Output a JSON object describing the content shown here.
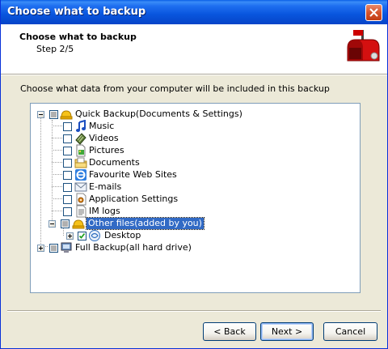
{
  "window": {
    "title": "Choose what to backup"
  },
  "header": {
    "title": "Choose what to backup",
    "step": "Step 2/5"
  },
  "instruction": "Choose what data from your computer will be included in this backup",
  "tree": {
    "quick_backup": "Quick Backup(Documents & Settings)",
    "items": [
      "Music",
      "Videos",
      "Pictures",
      "Documents",
      "Favourite Web Sites",
      "E-mails",
      "Application Settings",
      "IM logs"
    ],
    "other_files": "Other files(added by you)",
    "desktop": "Desktop",
    "full_backup": "Full Backup(all hard drive)"
  },
  "buttons": {
    "back": "< Back",
    "next": "Next >",
    "cancel": "Cancel"
  }
}
